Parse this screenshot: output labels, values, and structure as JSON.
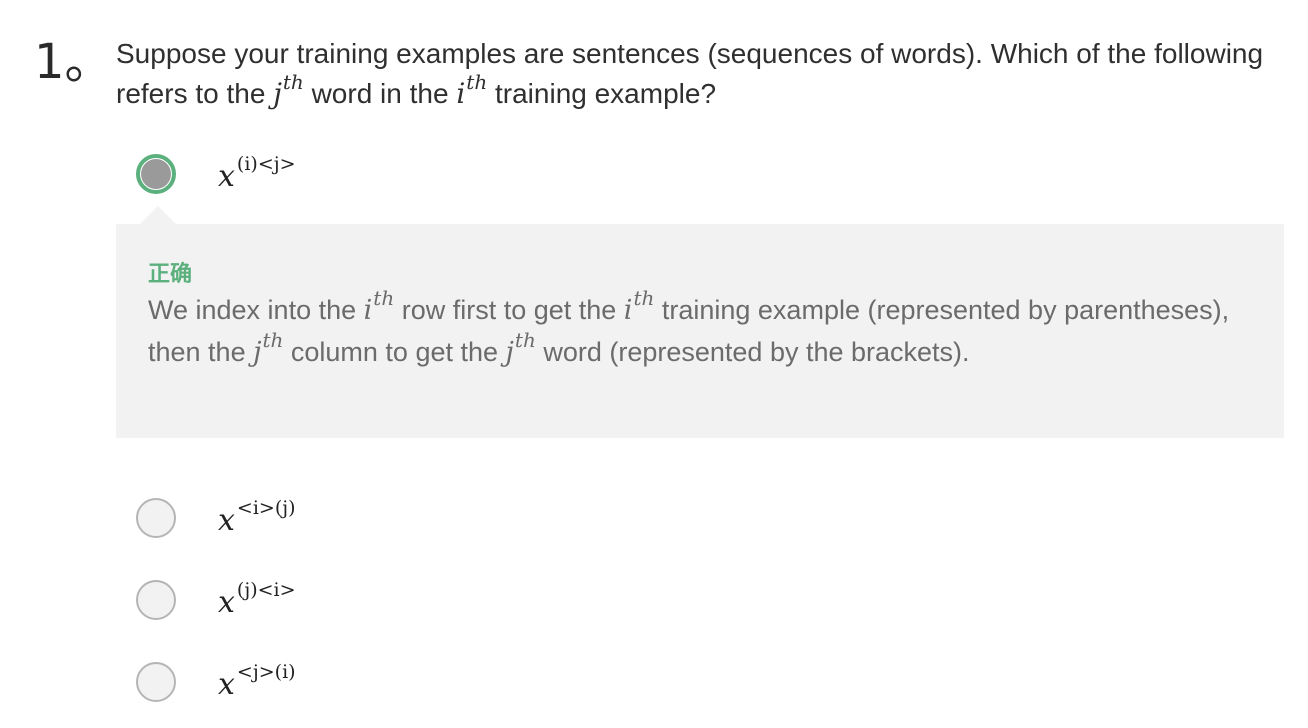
{
  "question": {
    "number": "1。",
    "text_part1": "Suppose your training examples are sentences (sequences of words). Which of the following refers to the ",
    "var_j": "j",
    "sup_th_1": "th",
    "text_part2": " word in the ",
    "var_i": "i",
    "sup_th_2": "th",
    "text_part3": " training example?"
  },
  "options": [
    {
      "base": "x",
      "index_a": "(i)",
      "index_b": "<j>",
      "selected": true
    },
    {
      "base": "x",
      "index_a": "<i>",
      "index_b": "(j)",
      "selected": false
    },
    {
      "base": "x",
      "index_a": "(j)",
      "index_b": "<i>",
      "selected": false
    },
    {
      "base": "x",
      "index_a": "<j>",
      "index_b": "(i)",
      "selected": false
    }
  ],
  "feedback": {
    "status": "正确",
    "t1": "We index into the ",
    "v1": "i",
    "s1": "th",
    "t2": " row first to get the ",
    "v2": "i",
    "s2": "th",
    "t3": " training example (represented by parentheses), then the ",
    "v3": "j",
    "s3": "th",
    "t4": " column to get the ",
    "v4": "j",
    "s4": "th",
    "t5": " word (represented by the brackets)."
  },
  "colors": {
    "correct_green": "#5bb07d",
    "feedback_bg": "#f2f2f2",
    "radio_border": "#b5b5b5"
  }
}
